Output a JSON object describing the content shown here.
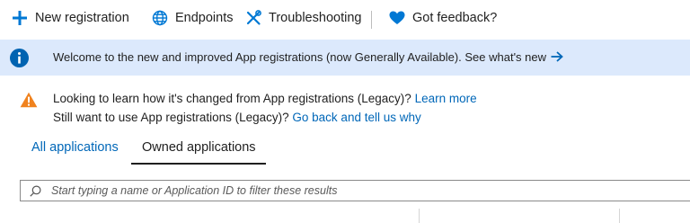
{
  "toolbar": {
    "new_registration": "New registration",
    "endpoints": "Endpoints",
    "troubleshooting": "Troubleshooting",
    "got_feedback": "Got feedback?"
  },
  "info_banner": {
    "text": "Welcome to the new and improved App registrations (now Generally Available). See what's new",
    "icon": "info-icon",
    "color": "#dce9fc"
  },
  "warning": {
    "line1_text": "Looking to learn how it's changed from App registrations (Legacy)?",
    "line1_link": "Learn more",
    "line2_text": "Still want to use App registrations (Legacy)?",
    "line2_link": "Go back and tell us why",
    "icon": "warning-icon"
  },
  "tabs": [
    {
      "label": "All applications",
      "active": false
    },
    {
      "label": "Owned applications",
      "active": true
    }
  ],
  "search": {
    "placeholder": "Start typing a name or Application ID to filter these results",
    "value": ""
  },
  "colors": {
    "accent": "#0067b8",
    "heart": "#0078d4",
    "warning": "#f0821e"
  }
}
